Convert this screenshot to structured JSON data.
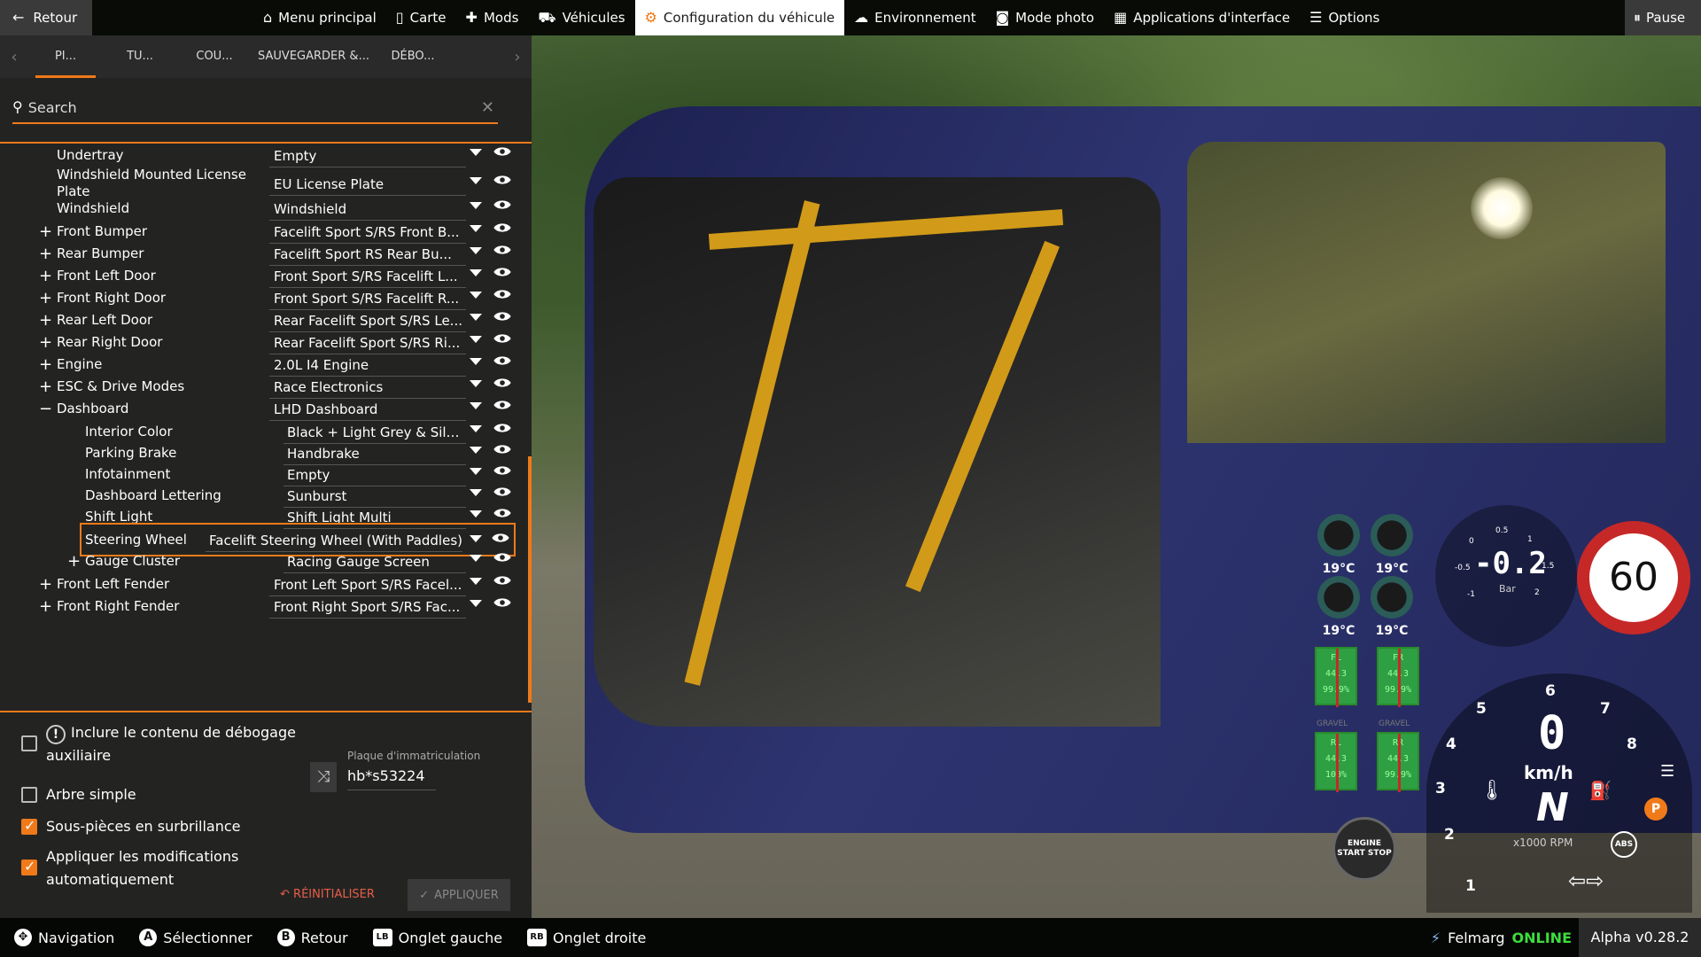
{
  "topbar": {
    "back_label": "Retour",
    "nav": [
      {
        "label": "Menu principal",
        "icon": "home-icon"
      },
      {
        "label": "Carte",
        "icon": "map-icon"
      },
      {
        "label": "Mods",
        "icon": "puzzle-icon"
      },
      {
        "label": "Véhicules",
        "icon": "car-icon"
      },
      {
        "label": "Configuration du véhicule",
        "icon": "car-config-icon",
        "active": true
      },
      {
        "label": "Environnement",
        "icon": "weather-icon"
      },
      {
        "label": "Mode photo",
        "icon": "camera-icon"
      },
      {
        "label": "Applications d'interface",
        "icon": "apps-icon"
      },
      {
        "label": "Options",
        "icon": "sliders-icon"
      }
    ],
    "pause_label": "Pause"
  },
  "panel": {
    "tabs": [
      "PI...",
      "TU...",
      "COU...",
      "SAUVEGARDER &...",
      "DÉBO..."
    ],
    "search_placeholder": "Search",
    "rows": [
      {
        "label": "Undertray",
        "value": "Empty",
        "level": 1,
        "pm": ""
      },
      {
        "label": "Windshield Mounted License Plate",
        "value": "EU License Plate",
        "level": 1,
        "pm": ""
      },
      {
        "label": "Windshield",
        "value": "Windshield",
        "level": 1,
        "pm": ""
      },
      {
        "label": "Front Bumper",
        "value": "Facelift Sport S/RS Front B...",
        "level": 1,
        "pm": "+"
      },
      {
        "label": "Rear Bumper",
        "value": "Facelift Sport RS Rear Bu...",
        "level": 1,
        "pm": "+"
      },
      {
        "label": "Front Left Door",
        "value": "Front Sport S/RS Facelift L...",
        "level": 1,
        "pm": "+"
      },
      {
        "label": "Front Right Door",
        "value": "Front Sport S/RS Facelift R...",
        "level": 1,
        "pm": "+"
      },
      {
        "label": "Rear Left Door",
        "value": "Rear Facelift Sport S/RS Le...",
        "level": 1,
        "pm": "+"
      },
      {
        "label": "Rear Right Door",
        "value": "Rear Facelift Sport S/RS Ri...",
        "level": 1,
        "pm": "+"
      },
      {
        "label": "Engine",
        "value": "2.0L I4 Engine",
        "level": 1,
        "pm": "+"
      },
      {
        "label": "ESC & Drive Modes",
        "value": "Race Electronics",
        "level": 1,
        "pm": "+"
      },
      {
        "label": "Dashboard",
        "value": "LHD Dashboard",
        "level": 1,
        "pm": "−"
      },
      {
        "label": "Interior Color",
        "value": "Black + Light Grey & Silver",
        "level": 2,
        "pm": ""
      },
      {
        "label": "Parking Brake",
        "value": "Handbrake",
        "level": 2,
        "pm": ""
      },
      {
        "label": "Infotainment",
        "value": "Empty",
        "level": 2,
        "pm": ""
      },
      {
        "label": "Dashboard Lettering",
        "value": "Sunburst",
        "level": 2,
        "pm": ""
      },
      {
        "label": "Shift Light",
        "value": "Shift Light Multi",
        "level": 2,
        "pm": ""
      },
      {
        "label": "Steering Wheel",
        "value": "Facelift Steering Wheel (With Paddles)",
        "level": 2,
        "pm": "",
        "highlighted": true
      },
      {
        "label": "Gauge Cluster",
        "value": "Racing Gauge Screen",
        "level": 2,
        "pm": "+"
      },
      {
        "label": "Front Left Fender",
        "value": "Front Left Sport S/RS Facel...",
        "level": 1,
        "pm": "+"
      },
      {
        "label": "Front Right Fender",
        "value": "Front Right Sport S/RS Fac...",
        "level": 1,
        "pm": "+"
      }
    ],
    "options": {
      "debug_content": "Inclure le contenu de débogage auxiliaire",
      "simple_tree": "Arbre simple",
      "highlight_subparts": "Sous-pièces en surbrillance",
      "auto_apply": "Appliquer les modifications automatiquement"
    },
    "plate_label": "Plaque d'immatriculation",
    "plate_value": "hb*s53224",
    "reset_label": "RÉINITIALISER",
    "apply_label": "APPLIQUER"
  },
  "hud": {
    "temps": [
      "19°C",
      "19°C",
      "19°C",
      "19°C"
    ],
    "tyres": [
      {
        "pos": "FL",
        "temp": "44.3",
        "wear": "99.9%"
      },
      {
        "pos": "FR",
        "temp": "44.3",
        "wear": "99.9%"
      },
      {
        "pos": "RL",
        "temp": "44.3",
        "wear": "100%"
      },
      {
        "pos": "RR",
        "temp": "44.3",
        "wear": "99.9%"
      }
    ],
    "tyre_surface": "GRAVEL",
    "boost_value": "-0.2",
    "boost_unit": "Bar",
    "boost_ticks": [
      "0",
      "0.5",
      "1",
      "1.5",
      "2",
      "-0.5",
      "-1"
    ],
    "speed_limit": "60",
    "speed": "0",
    "speed_unit": "km/h",
    "gear": "N",
    "rpm_unit": "x1000 RPM",
    "rpm_ticks": [
      "1",
      "2",
      "3",
      "4",
      "5",
      "6",
      "7",
      "8"
    ],
    "start_stop": "ENGINE START STOP"
  },
  "bottombar": {
    "hints": [
      {
        "key": "✥",
        "label": "Navigation"
      },
      {
        "key": "A",
        "label": "Sélectionner"
      },
      {
        "key": "B",
        "label": "Retour"
      },
      {
        "key": "LB",
        "label": "Onglet gauche"
      },
      {
        "key": "RB",
        "label": "Onglet droite"
      }
    ],
    "user": "Felmarg",
    "status": "ONLINE",
    "version": "Alpha v0.28.2"
  },
  "colors": {
    "accent": "#f07a1a",
    "online": "#3ddc3d",
    "reset": "#e85d4a"
  }
}
